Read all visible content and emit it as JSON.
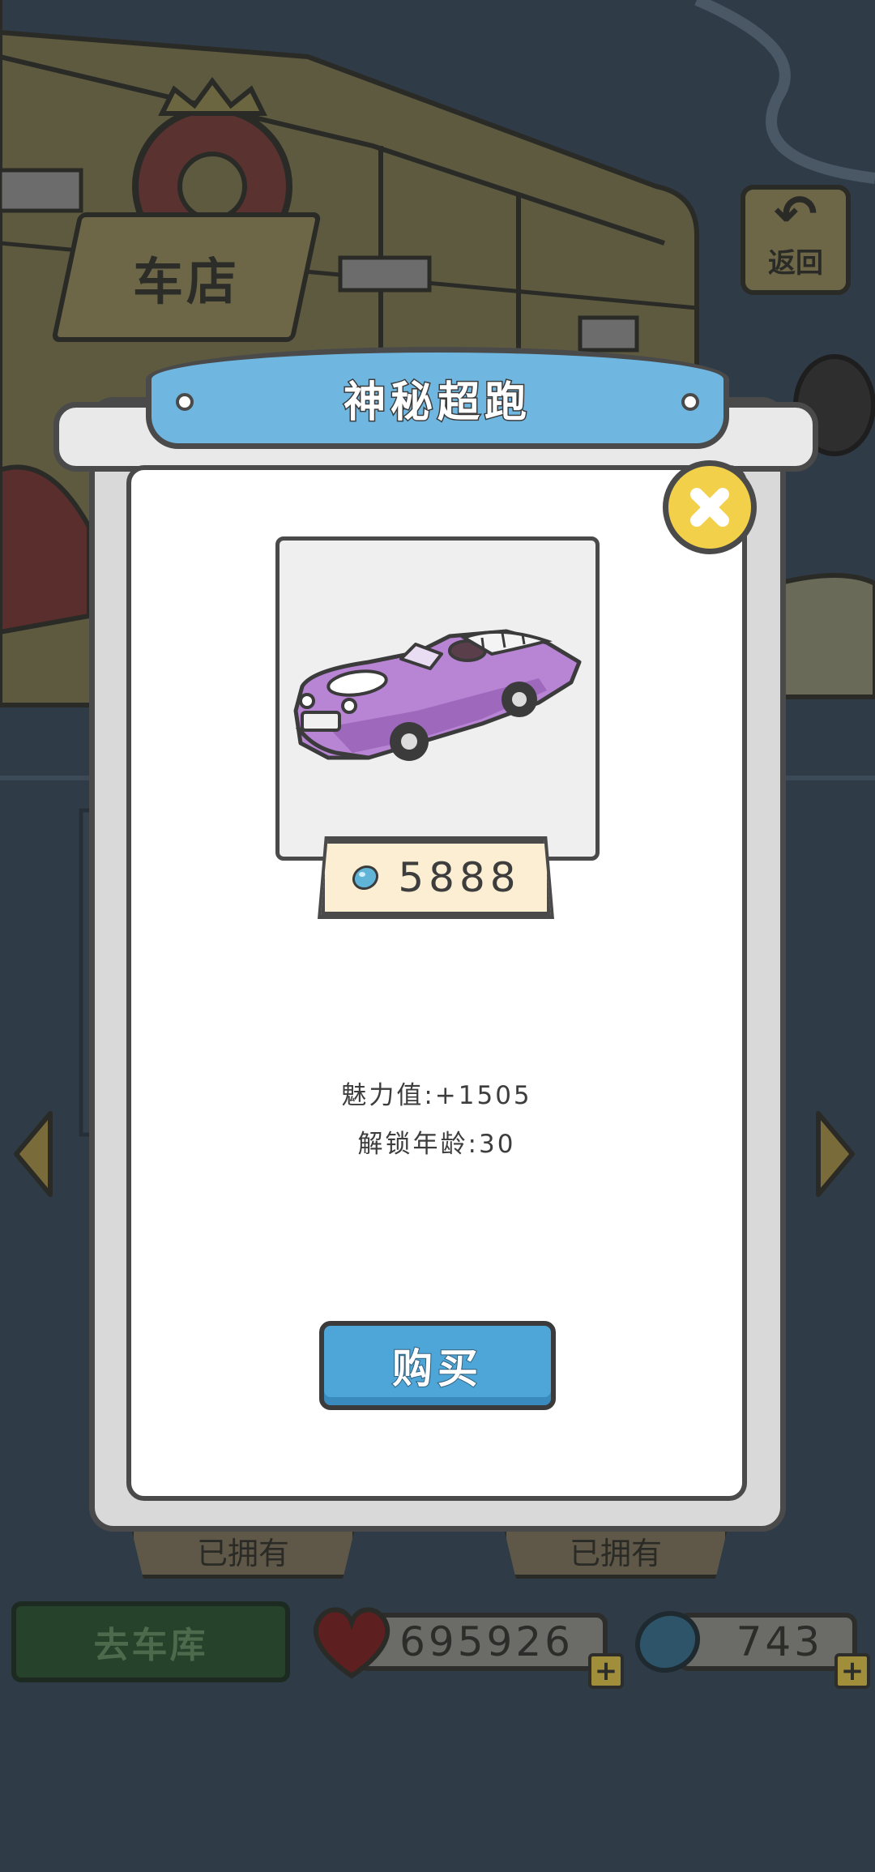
{
  "background": {
    "store_sign": "车店",
    "back_button_label": "返回",
    "owned_label_left": "已拥有",
    "owned_label_right": "已拥有",
    "garage_button_label": "去车库",
    "hearts": "695926",
    "gems": "743"
  },
  "dialog": {
    "title": "神秘超跑",
    "price": "5888",
    "charm": "魅力值:+1505",
    "unlock_age": "解锁年龄:30",
    "buy_label": "购买",
    "close_icon": "close-x-icon"
  },
  "colors": {
    "banner_blue": "#6fb7e0",
    "buy_button_blue": "#4ea6d8",
    "close_yellow": "#f2d04a",
    "car_purple": "#b884d4",
    "overlay": "#2f3c48"
  }
}
